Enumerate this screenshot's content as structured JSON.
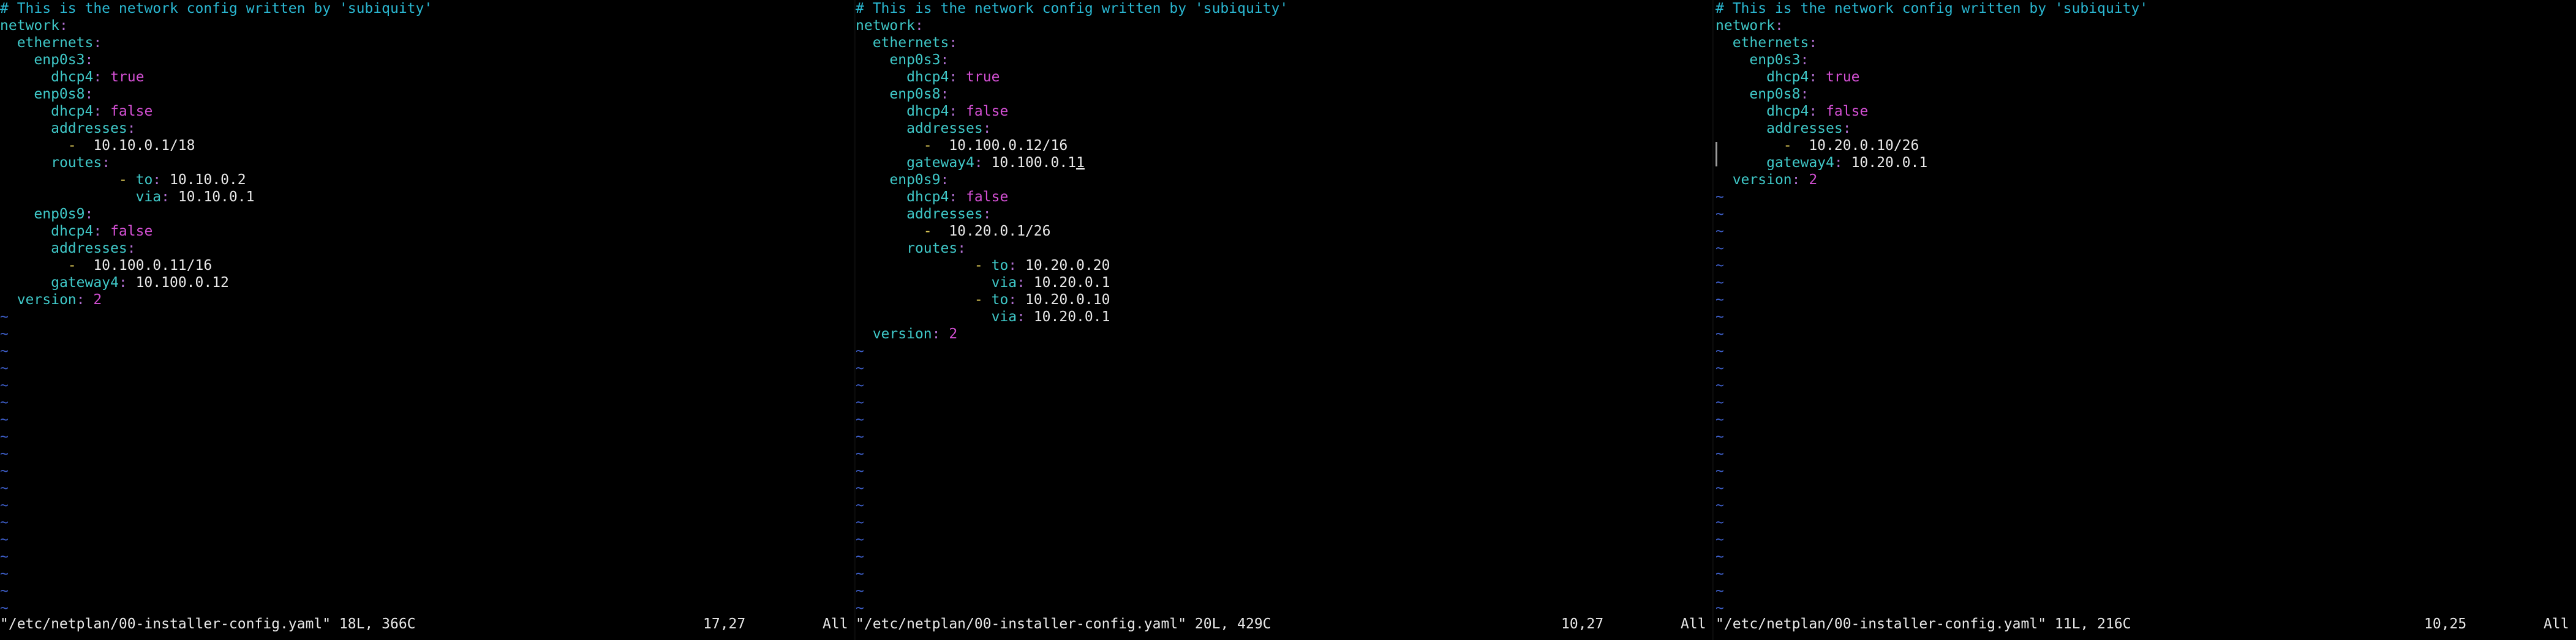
{
  "colors": {
    "background": "#000000",
    "comment": "#2ab7d1",
    "key": "#3fc8c8",
    "punct": "#b06fd0",
    "bool": "#d24fd2",
    "number": "#d24fd2",
    "dash": "#e9d35a",
    "plain": "#e8e8e8",
    "tilde": "#3d5ec9"
  },
  "panes": [
    {
      "lines": [
        [
          [
            "comment",
            "# This is the network config written by 'subiquity'"
          ]
        ],
        [
          [
            "key",
            "network"
          ],
          [
            "punct",
            ":"
          ]
        ],
        [
          [
            "plain",
            "  "
          ],
          [
            "key",
            "ethernets"
          ],
          [
            "punct",
            ":"
          ]
        ],
        [
          [
            "plain",
            "    "
          ],
          [
            "key",
            "enp0s3"
          ],
          [
            "punct",
            ":"
          ]
        ],
        [
          [
            "plain",
            "      "
          ],
          [
            "key",
            "dhcp4"
          ],
          [
            "punct",
            ":"
          ],
          [
            "plain",
            " "
          ],
          [
            "bool",
            "true"
          ]
        ],
        [
          [
            "plain",
            "    "
          ],
          [
            "key",
            "enp0s8"
          ],
          [
            "punct",
            ":"
          ]
        ],
        [
          [
            "plain",
            "      "
          ],
          [
            "key",
            "dhcp4"
          ],
          [
            "punct",
            ":"
          ],
          [
            "plain",
            " "
          ],
          [
            "bool",
            "false"
          ]
        ],
        [
          [
            "plain",
            "      "
          ],
          [
            "key",
            "addresses"
          ],
          [
            "punct",
            ":"
          ]
        ],
        [
          [
            "plain",
            "        "
          ],
          [
            "dash",
            "-"
          ],
          [
            "plain",
            "  10.10.0.1/18"
          ]
        ],
        [
          [
            "plain",
            "      "
          ],
          [
            "key",
            "routes"
          ],
          [
            "punct",
            ":"
          ]
        ],
        [
          [
            "plain",
            "              "
          ],
          [
            "dash",
            "-"
          ],
          [
            "plain",
            " "
          ],
          [
            "key",
            "to"
          ],
          [
            "punct",
            ":"
          ],
          [
            "plain",
            " 10.10.0.2"
          ]
        ],
        [
          [
            "plain",
            "                "
          ],
          [
            "key",
            "via"
          ],
          [
            "punct",
            ":"
          ],
          [
            "plain",
            " 10.10.0.1"
          ]
        ],
        [
          [
            "plain",
            "    "
          ],
          [
            "key",
            "enp0s9"
          ],
          [
            "punct",
            ":"
          ]
        ],
        [
          [
            "plain",
            "      "
          ],
          [
            "key",
            "dhcp4"
          ],
          [
            "punct",
            ":"
          ],
          [
            "plain",
            " "
          ],
          [
            "bool",
            "false"
          ]
        ],
        [
          [
            "plain",
            "      "
          ],
          [
            "key",
            "addresses"
          ],
          [
            "punct",
            ":"
          ]
        ],
        [
          [
            "plain",
            "        "
          ],
          [
            "dash",
            "-"
          ],
          [
            "plain",
            "  10.100.0.11/16"
          ]
        ],
        [
          [
            "plain",
            "      "
          ],
          [
            "key",
            "gateway4"
          ],
          [
            "punct",
            ":"
          ],
          [
            "plain",
            " 10.100.0.12"
          ]
        ],
        [
          [
            "plain",
            "  "
          ],
          [
            "key",
            "version"
          ],
          [
            "punct",
            ":"
          ],
          [
            "plain",
            " "
          ],
          [
            "num",
            "2"
          ]
        ]
      ],
      "tildes": 18,
      "status": {
        "file": "\"/etc/netplan/00-installer-config.yaml\" 18L, 366C",
        "pos": "17,27",
        "scroll": "All"
      }
    },
    {
      "lines": [
        [
          [
            "comment",
            "# This is the network config written by 'subiquity'"
          ]
        ],
        [
          [
            "key",
            "network"
          ],
          [
            "punct",
            ":"
          ]
        ],
        [
          [
            "plain",
            "  "
          ],
          [
            "key",
            "ethernets"
          ],
          [
            "punct",
            ":"
          ]
        ],
        [
          [
            "plain",
            "    "
          ],
          [
            "key",
            "enp0s3"
          ],
          [
            "punct",
            ":"
          ]
        ],
        [
          [
            "plain",
            "      "
          ],
          [
            "key",
            "dhcp4"
          ],
          [
            "punct",
            ":"
          ],
          [
            "plain",
            " "
          ],
          [
            "bool",
            "true"
          ]
        ],
        [
          [
            "plain",
            "    "
          ],
          [
            "key",
            "enp0s8"
          ],
          [
            "punct",
            ":"
          ]
        ],
        [
          [
            "plain",
            "      "
          ],
          [
            "key",
            "dhcp4"
          ],
          [
            "punct",
            ":"
          ],
          [
            "plain",
            " "
          ],
          [
            "bool",
            "false"
          ]
        ],
        [
          [
            "plain",
            "      "
          ],
          [
            "key",
            "addresses"
          ],
          [
            "punct",
            ":"
          ]
        ],
        [
          [
            "plain",
            "        "
          ],
          [
            "dash",
            "-"
          ],
          [
            "plain",
            "  10.100.0.12/16"
          ]
        ],
        [
          [
            "plain",
            "      "
          ],
          [
            "key",
            "gateway4"
          ],
          [
            "punct",
            ":"
          ],
          [
            "plain",
            " 10.100.0.1"
          ],
          [
            "cursor",
            "1"
          ]
        ],
        [
          [
            "plain",
            "    "
          ],
          [
            "key",
            "enp0s9"
          ],
          [
            "punct",
            ":"
          ]
        ],
        [
          [
            "plain",
            "      "
          ],
          [
            "key",
            "dhcp4"
          ],
          [
            "punct",
            ":"
          ],
          [
            "plain",
            " "
          ],
          [
            "bool",
            "false"
          ]
        ],
        [
          [
            "plain",
            "      "
          ],
          [
            "key",
            "addresses"
          ],
          [
            "punct",
            ":"
          ]
        ],
        [
          [
            "plain",
            "        "
          ],
          [
            "dash",
            "-"
          ],
          [
            "plain",
            "  10.20.0.1/26"
          ]
        ],
        [
          [
            "plain",
            "      "
          ],
          [
            "key",
            "routes"
          ],
          [
            "punct",
            ":"
          ]
        ],
        [
          [
            "plain",
            "              "
          ],
          [
            "dash",
            "-"
          ],
          [
            "plain",
            " "
          ],
          [
            "key",
            "to"
          ],
          [
            "punct",
            ":"
          ],
          [
            "plain",
            " 10.20.0.20"
          ]
        ],
        [
          [
            "plain",
            "                "
          ],
          [
            "key",
            "via"
          ],
          [
            "punct",
            ":"
          ],
          [
            "plain",
            " 10.20.0.1"
          ]
        ],
        [
          [
            "plain",
            "              "
          ],
          [
            "dash",
            "-"
          ],
          [
            "plain",
            " "
          ],
          [
            "key",
            "to"
          ],
          [
            "punct",
            ":"
          ],
          [
            "plain",
            " 10.20.0.10"
          ]
        ],
        [
          [
            "plain",
            "                "
          ],
          [
            "key",
            "via"
          ],
          [
            "punct",
            ":"
          ],
          [
            "plain",
            " 10.20.0.1"
          ]
        ],
        [
          [
            "plain",
            "  "
          ],
          [
            "key",
            "version"
          ],
          [
            "punct",
            ":"
          ],
          [
            "plain",
            " "
          ],
          [
            "num",
            "2"
          ]
        ]
      ],
      "tildes": 16,
      "status": {
        "file": "\"/etc/netplan/00-installer-config.yaml\" 20L, 429C",
        "pos": "10,27",
        "scroll": "All"
      }
    },
    {
      "lines": [
        [
          [
            "comment",
            "# This is the network config written by 'subiquity'"
          ]
        ],
        [
          [
            "key",
            "network"
          ],
          [
            "punct",
            ":"
          ]
        ],
        [
          [
            "plain",
            "  "
          ],
          [
            "key",
            "ethernets"
          ],
          [
            "punct",
            ":"
          ]
        ],
        [
          [
            "plain",
            "    "
          ],
          [
            "key",
            "enp0s3"
          ],
          [
            "punct",
            ":"
          ]
        ],
        [
          [
            "plain",
            "      "
          ],
          [
            "key",
            "dhcp4"
          ],
          [
            "punct",
            ":"
          ],
          [
            "plain",
            " "
          ],
          [
            "bool",
            "true"
          ]
        ],
        [
          [
            "plain",
            "    "
          ],
          [
            "key",
            "enp0s8"
          ],
          [
            "punct",
            ":"
          ]
        ],
        [
          [
            "plain",
            "      "
          ],
          [
            "key",
            "dhcp4"
          ],
          [
            "punct",
            ":"
          ],
          [
            "plain",
            " "
          ],
          [
            "bool",
            "false"
          ]
        ],
        [
          [
            "plain",
            "      "
          ],
          [
            "key",
            "addresses"
          ],
          [
            "punct",
            ":"
          ]
        ],
        [
          [
            "plain",
            "        "
          ],
          [
            "dash",
            "-"
          ],
          [
            "plain",
            "  10.20.0.10/26"
          ]
        ],
        [
          [
            "plain",
            "      "
          ],
          [
            "key",
            "gateway4"
          ],
          [
            "punct",
            ":"
          ],
          [
            "plain",
            " 10.20.0.1"
          ]
        ],
        [
          [
            "plain",
            "  "
          ],
          [
            "key",
            "version"
          ],
          [
            "punct",
            ":"
          ],
          [
            "plain",
            " "
          ],
          [
            "num",
            "2"
          ]
        ]
      ],
      "tildes": 25,
      "status": {
        "file": "\"/etc/netplan/00-installer-config.yaml\" 11L, 216C",
        "pos": "10,25",
        "scroll": "All"
      }
    }
  ]
}
